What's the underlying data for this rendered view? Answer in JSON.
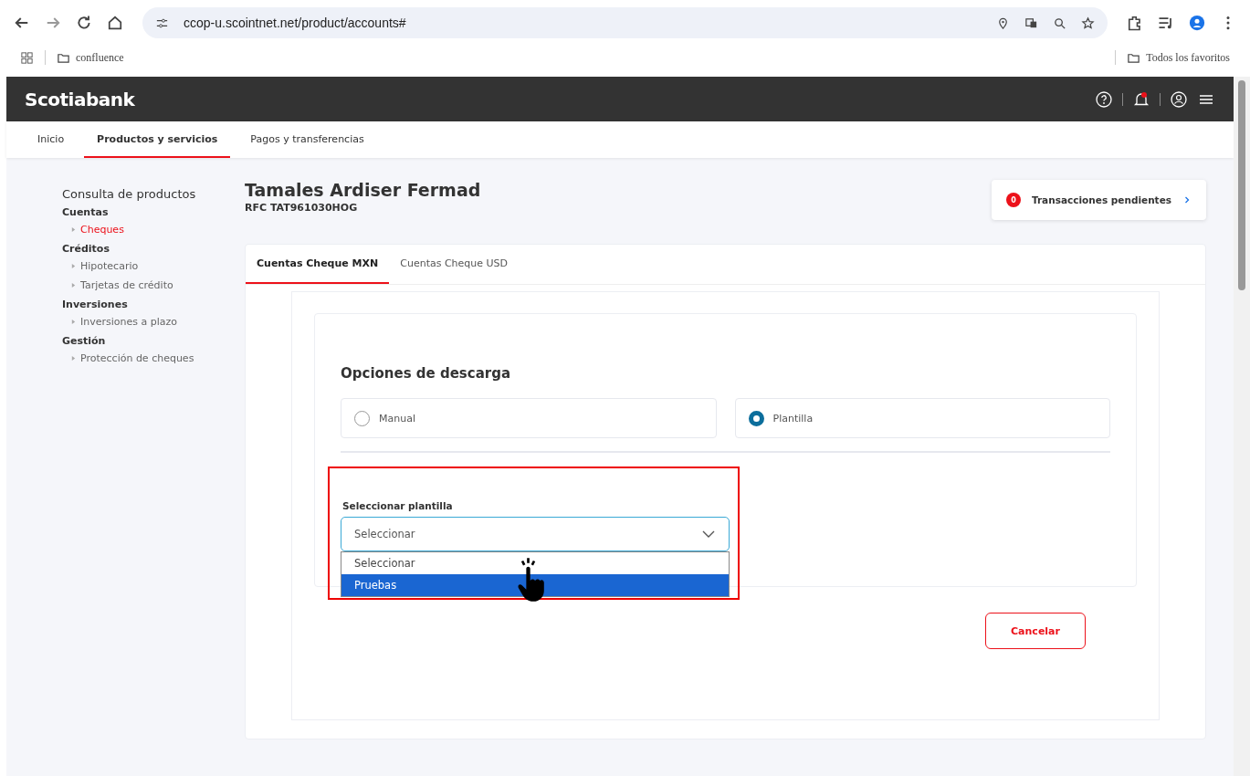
{
  "browser": {
    "url": "ccop-u.scointnet.net/product/accounts#",
    "bookmarks": [
      "confluence"
    ],
    "other_bookmarks": "Todos los favoritos"
  },
  "header": {
    "brand": "Scotiabank",
    "notifications": true
  },
  "nav": [
    {
      "label": "Inicio",
      "selected": false
    },
    {
      "label": "Productos y servicios",
      "selected": true
    },
    {
      "label": "Pagos y transferencias",
      "selected": false
    }
  ],
  "sidebar": {
    "title": "Consulta de productos",
    "groups": [
      {
        "label": "Cuentas",
        "children": [
          {
            "label": "Cheques",
            "selected": true
          }
        ]
      },
      {
        "label": "Créditos",
        "children": [
          {
            "label": "Hipotecario",
            "selected": false
          },
          {
            "label": "Tarjetas de crédito",
            "selected": false
          }
        ]
      },
      {
        "label": "Inversiones",
        "children": [
          {
            "label": "Inversiones a plazo",
            "selected": false
          }
        ]
      },
      {
        "label": "Gestión",
        "children": [
          {
            "label": "Protección de cheques",
            "selected": false
          }
        ]
      }
    ]
  },
  "customer": {
    "name": "Tamales Ardiser Fermad",
    "rfc": "RFC TAT961030HOG"
  },
  "pending": {
    "count": "0",
    "label": "Transacciones pendientes"
  },
  "tabs": [
    {
      "label": "Cuentas Cheque MXN",
      "selected": true
    },
    {
      "label": "Cuentas Cheque USD",
      "selected": false
    }
  ],
  "download": {
    "title": "Opciones de descarga",
    "options": [
      {
        "label": "Manual",
        "selected": false
      },
      {
        "label": "Plantilla",
        "selected": true
      }
    ]
  },
  "template_select": {
    "label": "Seleccionar plantilla",
    "value": "Seleccionar",
    "expanded": true,
    "options": [
      {
        "label": "Seleccionar",
        "highlighted": false
      },
      {
        "label": "Pruebas",
        "highlighted": true
      }
    ]
  },
  "cancel_button": "Cancelar"
}
